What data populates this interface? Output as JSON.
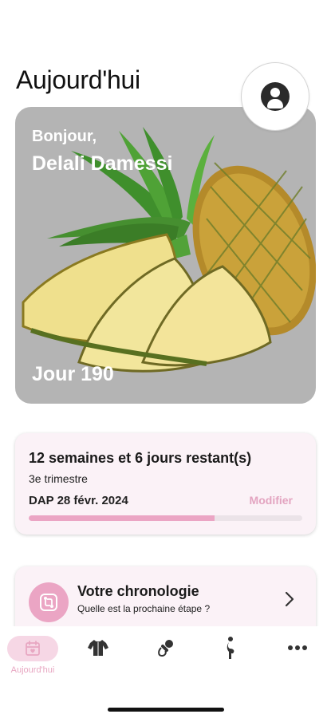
{
  "header": {
    "title": "Aujourd'hui"
  },
  "profile": {
    "icon": "user-circle-icon"
  },
  "hero": {
    "greeting": "Bonjour,",
    "name": "Delali Damessi",
    "day_label": "Jour 190",
    "image": "pineapple-image"
  },
  "progress_card": {
    "remaining": "12 semaines et 6 jours restant(s)",
    "trimester": "3e trimestre",
    "due_date": "DAP 28 févr. 2024",
    "modify_label": "Modifier",
    "progress_fraction": 0.68
  },
  "timeline_card": {
    "title": "Votre chronologie",
    "subtitle": "Quelle est la prochaine étape ?",
    "icon": "timeline-icon"
  },
  "tabbar": {
    "items": [
      {
        "label": "Aujourd'hui",
        "icon": "calendar-icon",
        "active": true
      },
      {
        "label": "",
        "icon": "baby-clothes-icon",
        "active": false
      },
      {
        "label": "",
        "icon": "pacifier-icon",
        "active": false
      },
      {
        "label": "",
        "icon": "pregnant-icon",
        "active": false
      },
      {
        "label": "",
        "icon": "more-icon",
        "active": false
      }
    ]
  },
  "colors": {
    "accent_pink": "#eba5c4",
    "card_bg": "#fbf2f7",
    "hero_bg": "#b4b4b4"
  }
}
